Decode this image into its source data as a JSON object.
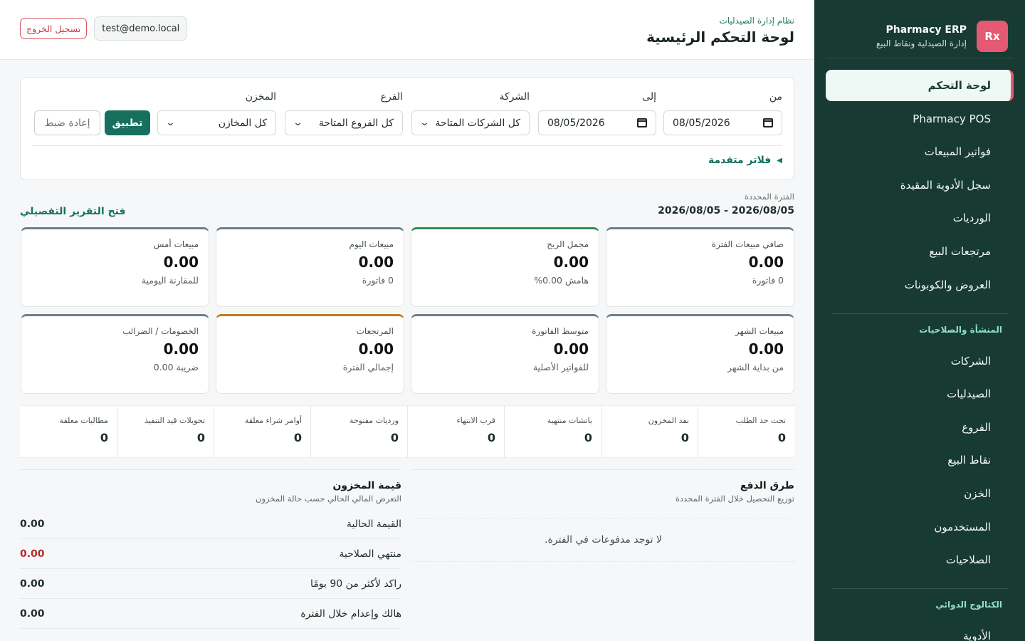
{
  "brand": {
    "logo": "Rx",
    "title": "Pharmacy ERP",
    "subtitle": "إدارة الصيدلية ونقاط البيع"
  },
  "nav": {
    "items": [
      "لوحة التحكم",
      "Pharmacy POS",
      "فواتير المبيعات",
      "سجل الأدوية المقيدة",
      "الورديات",
      "مرتجعات البيع",
      "العروض والكوبونات"
    ],
    "section1": "المنشأة والصلاحيات",
    "section1_items": [
      "الشركات",
      "الصيدليات",
      "الفروع",
      "نقاط البيع",
      "الخزن",
      "المستخدمون",
      "الصلاحيات"
    ],
    "section2": "الكتالوج الدوائي",
    "section2_items": [
      "الأدوية"
    ]
  },
  "header": {
    "kicker": "نظام إدارة الصيدليات",
    "title": "لوحة التحكم الرئيسية",
    "user": "test@demo.local",
    "logout": "تسجيل الخروج"
  },
  "filters": {
    "from_label": "من",
    "from_value": "08/05/2026",
    "to_label": "إلى",
    "to_value": "08/05/2026",
    "company_label": "الشركة",
    "company_value": "كل الشركات المتاحة",
    "branch_label": "الفرع",
    "branch_value": "كل الفروع المتاحة",
    "warehouse_label": "المخزن",
    "warehouse_value": "كل المخازن",
    "apply": "تطبيق",
    "reset": "إعادة ضبط",
    "advanced": "فلاتر متقدمة"
  },
  "period": {
    "label": "الفترة المحددة",
    "value": "2026/08/05 - 2026/08/05",
    "open_report": "فتح التقرير التفصيلي"
  },
  "cards": [
    {
      "label": "صافي مبيعات الفترة",
      "value": "0.00",
      "sub": "0 فاتورة",
      "accent": "#6c7f8a"
    },
    {
      "label": "مجمل الربح",
      "value": "0.00",
      "sub": "هامش 0.00%",
      "accent": "#2f8a57"
    },
    {
      "label": "مبيعات اليوم",
      "value": "0.00",
      "sub": "0 فاتورة",
      "accent": "#6c7f8a"
    },
    {
      "label": "مبيعات أمس",
      "value": "0.00",
      "sub": "للمقارنة اليومية",
      "accent": "#6c7f8a"
    },
    {
      "label": "مبيعات الشهر",
      "value": "0.00",
      "sub": "من بداية الشهر",
      "accent": "#6c7f8a"
    },
    {
      "label": "متوسط الفاتورة",
      "value": "0.00",
      "sub": "للفواتير الأصلية",
      "accent": "#6c7f8a"
    },
    {
      "label": "المرتجعات",
      "value": "0.00",
      "sub": "إجمالي الفترة",
      "accent": "#c27a1c"
    },
    {
      "label": "الخصومات / الضرائب",
      "value": "0.00",
      "sub": "ضريبة 0.00",
      "accent": "#6c7f8a"
    }
  ],
  "stats": [
    {
      "label": "تحت حد الطلب",
      "value": "0"
    },
    {
      "label": "نفد المخزون",
      "value": "0"
    },
    {
      "label": "باتشات منتهية",
      "value": "0"
    },
    {
      "label": "قرب الانتهاء",
      "value": "0"
    },
    {
      "label": "ورديات مفتوحة",
      "value": "0"
    },
    {
      "label": "أوامر شراء معلقة",
      "value": "0"
    },
    {
      "label": "تحويلات قيد التنفيذ",
      "value": "0"
    },
    {
      "label": "مطالبات معلقة",
      "value": "0"
    }
  ],
  "payments": {
    "title": "طرق الدفع",
    "subtitle": "توزيع التحصيل خلال الفترة المحددة",
    "empty": "لا توجد مدفوعات في الفترة."
  },
  "inventory": {
    "title": "قيمة المخزون",
    "subtitle": "التعرض المالي الحالي حسب حالة المخزون",
    "rows": [
      {
        "label": "القيمة الحالية",
        "value": "0.00"
      },
      {
        "label": "منتهي الصلاحية",
        "value": "0.00"
      },
      {
        "label": "راكد لأكثر من 90 يومًا",
        "value": "0.00"
      },
      {
        "label": "هالك وإعدام خلال الفترة",
        "value": "0.00"
      }
    ]
  },
  "colors": {
    "sidebar": "#173a33",
    "primary": "#17705e",
    "danger": "#c73a48",
    "logo": "#e35a72"
  }
}
